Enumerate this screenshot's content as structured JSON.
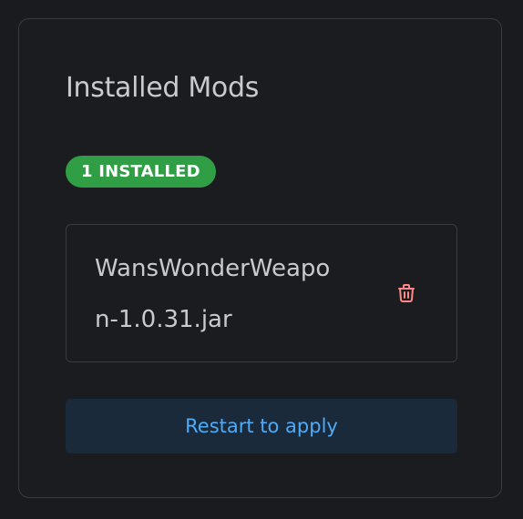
{
  "panel": {
    "title": "Installed Mods",
    "badge_text": "1 INSTALLED",
    "badge_color": "#2f9e44"
  },
  "mods": [
    {
      "filename": "WansWonderWeapon-1.0.31.jar",
      "delete_icon": "trash-icon",
      "delete_icon_color": "#ff8787"
    }
  ],
  "actions": {
    "restart_label": "Restart to apply",
    "restart_color": "#4dabf7"
  }
}
